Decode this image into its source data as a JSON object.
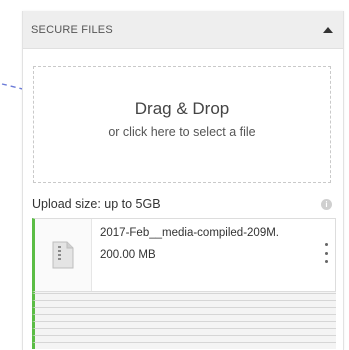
{
  "panel": {
    "title": "SECURE FILES",
    "collapse_icon": "caret-up-icon"
  },
  "dropzone": {
    "title": "Drag & Drop",
    "subtitle": "or click here to select a file"
  },
  "upload": {
    "size_label": "Upload size: up to 5GB",
    "info_icon": "info-icon"
  },
  "files": [
    {
      "name": "2017-Feb__media-compiled-209M.",
      "size": "200.00 MB",
      "icon": "file-zip-icon",
      "menu_icon": "kebab-menu-icon"
    }
  ],
  "colors": {
    "accent_green": "#5bbd45",
    "header_bg": "#eeeeee",
    "hint_arrow": "#6b7bd8"
  }
}
